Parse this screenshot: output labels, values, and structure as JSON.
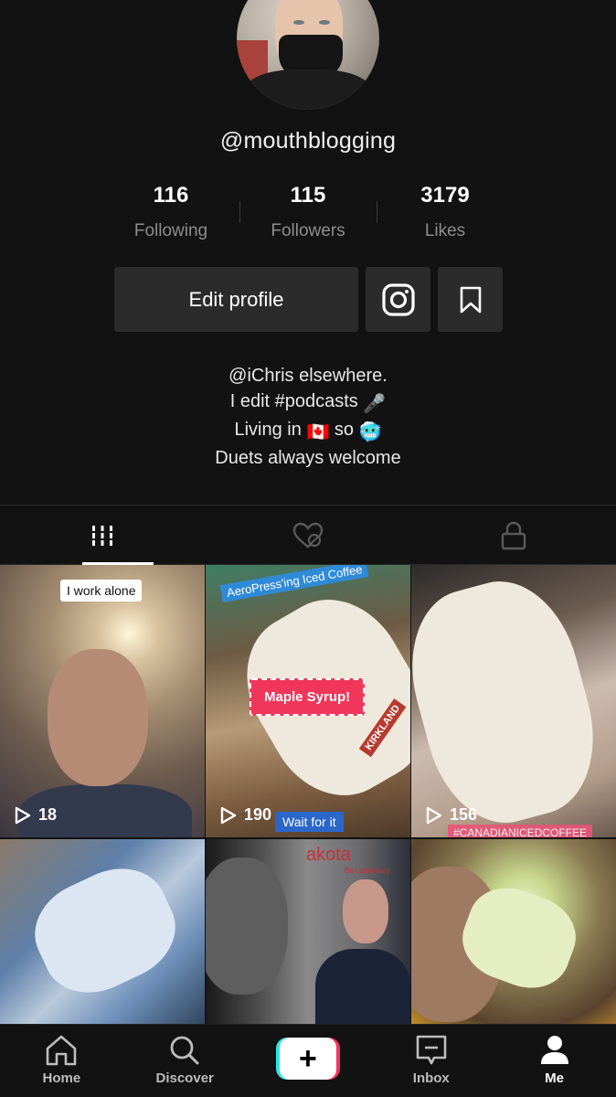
{
  "profile": {
    "username": "@mouthblogging"
  },
  "stats": [
    {
      "value": "116",
      "label": "Following"
    },
    {
      "value": "115",
      "label": "Followers"
    },
    {
      "value": "3179",
      "label": "Likes"
    }
  ],
  "actions": {
    "edit_label": "Edit profile"
  },
  "bio": {
    "line1": "@iChris elsewhere.",
    "line2_text": "I edit #podcasts",
    "line2_emoji": "🎤",
    "line3_pre": "Living in",
    "line3_flag": "🇨🇦",
    "line3_mid": "so",
    "line3_emoji": "🥶",
    "line4": "Duets always welcome"
  },
  "tabs": [
    {
      "icon": "grid-icon",
      "active": true
    },
    {
      "icon": "liked-hidden-icon",
      "active": false
    },
    {
      "icon": "lock-icon",
      "active": false
    }
  ],
  "videos": [
    {
      "views": "18",
      "stickers": [
        "I work alone"
      ]
    },
    {
      "views": "190",
      "stickers": [
        "AeroPress'ing Iced Coffee",
        "Maple Syrup!",
        "Wait for it"
      ],
      "label": "KIRKLAND"
    },
    {
      "views": "156",
      "stickers": [
        "#CANADIANICEDCOFFEE"
      ]
    },
    {
      "views": "",
      "stickers": []
    },
    {
      "views": "",
      "stickers": [
        "akota",
        "Be Legendary"
      ]
    },
    {
      "views": "",
      "stickers": []
    }
  ],
  "nav": [
    {
      "label": "Home",
      "icon": "home-icon"
    },
    {
      "label": "Discover",
      "icon": "search-icon"
    },
    {
      "label": "",
      "icon": "plus-icon"
    },
    {
      "label": "Inbox",
      "icon": "inbox-icon"
    },
    {
      "label": "Me",
      "icon": "person-icon",
      "active": true
    }
  ],
  "colors": {
    "background": "#121212",
    "button": "#2b2b2b",
    "accent_red": "#f6345c",
    "accent_cyan": "#2ce4e4"
  }
}
